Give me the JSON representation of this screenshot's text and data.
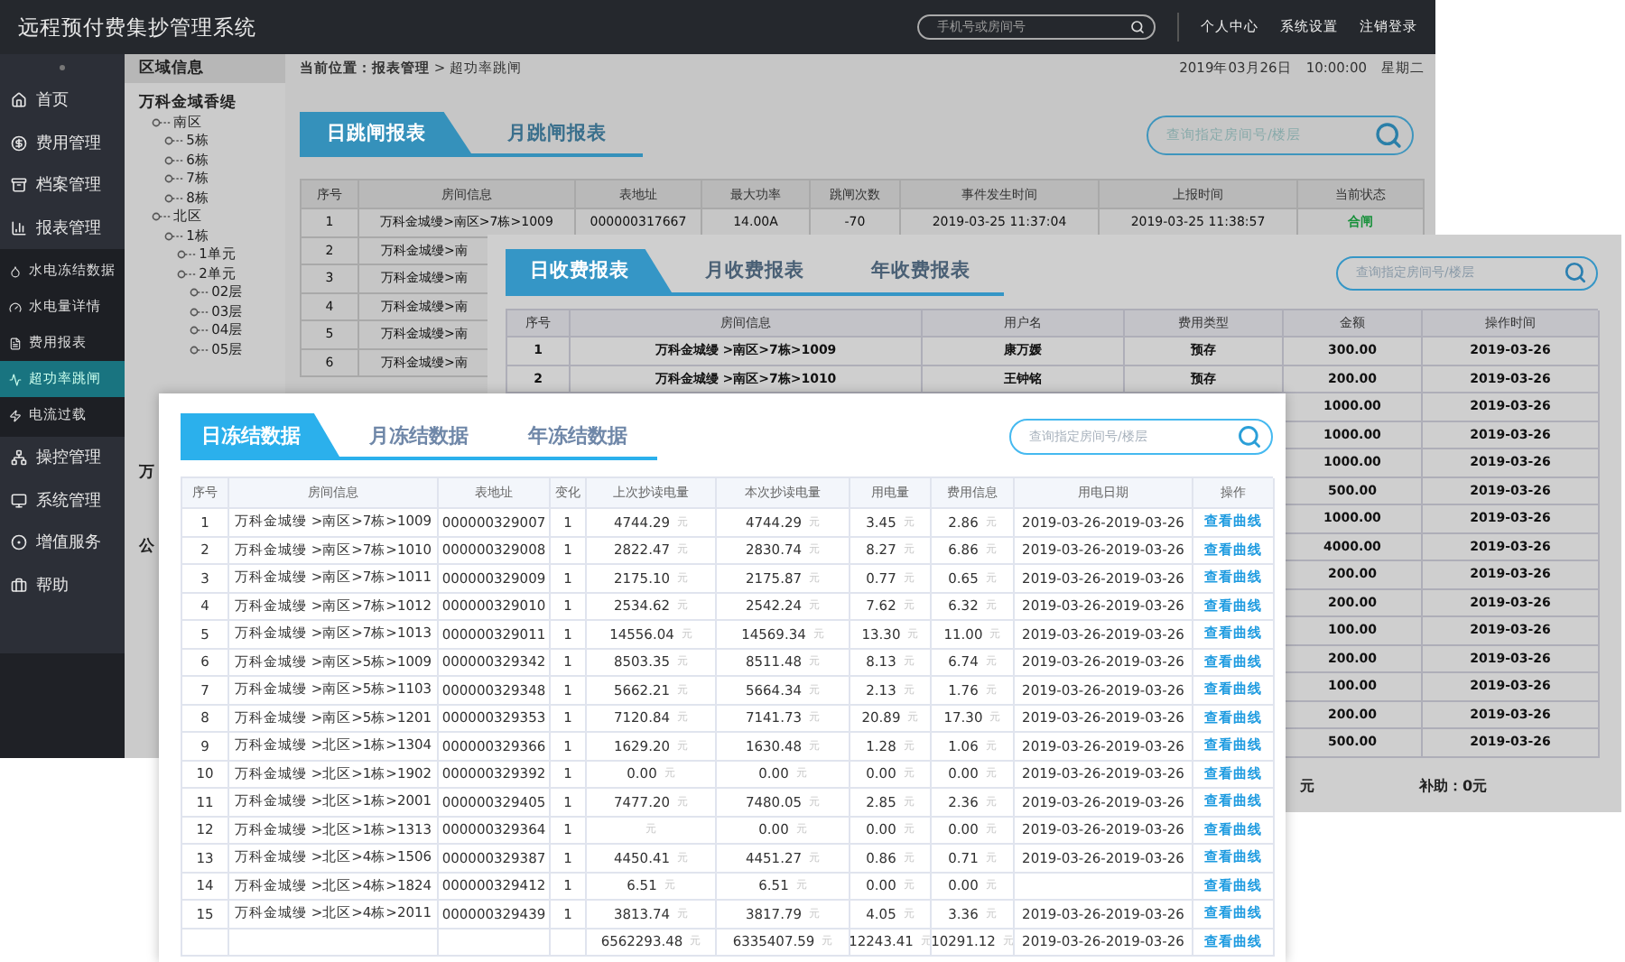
{
  "trip_window": {
    "title": "远程预付费集抄管理系统",
    "search": {
      "placeholder": "手机号或房间号"
    },
    "top_links": [
      "个人中心",
      "系统设置",
      "注销登录"
    ],
    "menu": [
      {
        "label": "首页",
        "selected": false
      },
      {
        "label": "费用管理",
        "selected": false
      },
      {
        "label": "档案管理",
        "selected": false
      },
      {
        "label": "报表管理",
        "selected": false,
        "expanded": true,
        "children": [
          {
            "label": "水电冻结数据",
            "selected": false
          },
          {
            "label": "水电量详情",
            "selected": false
          },
          {
            "label": "费用报表",
            "selected": false
          },
          {
            "label": "超功率跳闸",
            "selected": true
          },
          {
            "label": "电流过载",
            "selected": false
          }
        ]
      },
      {
        "label": "操控管理",
        "selected": false
      },
      {
        "label": "系统管理",
        "selected": false
      },
      {
        "label": "增值服务",
        "selected": false
      },
      {
        "label": "帮助",
        "selected": false
      }
    ],
    "region_panel": {
      "title": "区域信息",
      "tree": [
        {
          "label": "万科金域香缇",
          "children": [
            {
              "label": "南区",
              "children": [
                {
                  "label": "5栋"
                },
                {
                  "label": "6栋"
                },
                {
                  "label": "7栋"
                },
                {
                  "label": "8栋"
                }
              ]
            },
            {
              "label": "北区",
              "children": [
                {
                  "label": "1栋",
                  "children": [
                    {
                      "label": "1单元"
                    },
                    {
                      "label": "2单元",
                      "children": [
                        {
                          "label": "02层"
                        },
                        {
                          "label": "03层"
                        },
                        {
                          "label": "04层"
                        },
                        {
                          "label": "05层"
                        }
                      ]
                    }
                  ]
                }
              ]
            }
          ]
        },
        {
          "label": "万"
        },
        {
          "label": "公"
        }
      ]
    },
    "breadcrumb": "**当前位置：报表管理** > 超功率跳闸",
    "datetime": [
      "2019年03月26日",
      "10:00:00",
      "星期二"
    ],
    "tabs": [
      {
        "label": "日跳闸报表",
        "selected": true
      },
      {
        "label": "月跳闸报表",
        "selected": false
      }
    ],
    "table_search": {
      "placeholder": "查询指定房间号/楼层"
    },
    "table": {
      "columns": [
        {
          "label": "序号",
          "kind": "text"
        },
        {
          "label": "房间信息",
          "kind": "text"
        },
        {
          "label": "表地址",
          "kind": "text"
        },
        {
          "label": "最大功率",
          "kind": "text"
        },
        {
          "label": "跳闸次数",
          "kind": "text"
        },
        {
          "label": "事件发生时间",
          "kind": "text"
        },
        {
          "label": "上报时间",
          "kind": "text"
        },
        {
          "label": "当前状态",
          "kind": "status"
        }
      ],
      "rows": [
        {
          "cells": [
            "1",
            "万科金城缦>南区>7栋>1009",
            "000000317667",
            "14.00A",
            "-70",
            "2019-03-25  11:37:04",
            "2019-03-25  11:38:57",
            "合闸"
          ]
        },
        {
          "cells": [
            "2",
            "万科金城缦>南"
          ]
        },
        {
          "cells": [
            "3",
            "万科金城缦>南"
          ]
        },
        {
          "cells": [
            "4",
            "万科金城缦>南"
          ]
        },
        {
          "cells": [
            "5",
            "万科金城缦>南"
          ]
        },
        {
          "cells": [
            "6",
            "万科金城缦>南"
          ]
        }
      ]
    }
  },
  "fee_window": {
    "tabs": [
      {
        "label": "日收费报表",
        "selected": true
      },
      {
        "label": "月收费报表",
        "selected": false
      },
      {
        "label": "年收费报表",
        "selected": false
      }
    ],
    "search": {
      "placeholder": "查询指定房间号/楼层"
    },
    "table": {
      "columns": [
        {
          "label": "序号"
        },
        {
          "label": "房间信息"
        },
        {
          "label": "用户名"
        },
        {
          "label": "费用类型"
        },
        {
          "label": "金额"
        },
        {
          "label": "操作时间"
        }
      ],
      "rows": [
        {
          "cells": [
            "1",
            "万科金城缦 >南区>7栋>1009",
            "康万媛",
            "预存",
            "300.00",
            "2019-03-26"
          ]
        },
        {
          "cells": [
            "2",
            "万科金城缦 >南区>7栋>1010",
            "王钟铭",
            "预存",
            "200.00",
            "2019-03-26"
          ]
        },
        {
          "tail": [
            "1000.00",
            "2019-03-26"
          ]
        },
        {
          "tail": [
            "1000.00",
            "2019-03-26"
          ]
        },
        {
          "tail": [
            "1000.00",
            "2019-03-26"
          ]
        },
        {
          "tail": [
            "500.00",
            "2019-03-26"
          ]
        },
        {
          "tail": [
            "1000.00",
            "2019-03-26"
          ]
        },
        {
          "tail": [
            "4000.00",
            "2019-03-26"
          ]
        },
        {
          "tail": [
            "200.00",
            "2019-03-26"
          ]
        },
        {
          "tail": [
            "200.00",
            "2019-03-26"
          ]
        },
        {
          "tail": [
            "100.00",
            "2019-03-26"
          ]
        },
        {
          "tail": [
            "200.00",
            "2019-03-26"
          ]
        },
        {
          "tail": [
            "100.00",
            "2019-03-26"
          ]
        },
        {
          "tail": [
            "200.00",
            "2019-03-26"
          ]
        },
        {
          "tail": [
            "500.00",
            "2019-03-26"
          ]
        }
      ]
    },
    "footer": [
      "元",
      "补助：0元"
    ]
  },
  "freeze_window": {
    "tabs": [
      {
        "label": "日冻结数据",
        "selected": true
      },
      {
        "label": "月冻结数据",
        "selected": false
      },
      {
        "label": "年冻结数据",
        "selected": false
      }
    ],
    "search": {
      "placeholder": "查询指定房间号/楼层"
    },
    "table": {
      "columns": [
        {
          "label": "序号",
          "kind": "text"
        },
        {
          "label": "房间信息",
          "kind": "text"
        },
        {
          "label": "表地址",
          "kind": "text"
        },
        {
          "label": "变化",
          "kind": "text"
        },
        {
          "label": "上次抄读电量",
          "kind": "reading"
        },
        {
          "label": "本次抄读电量",
          "kind": "reading"
        },
        {
          "label": "用电量",
          "kind": "reading"
        },
        {
          "label": "费用信息",
          "kind": "reading"
        },
        {
          "label": "用电日期",
          "kind": "text"
        },
        {
          "label": "操作",
          "kind": "link"
        }
      ],
      "rows": [
        {
          "cells": [
            "1",
            "万科金城缦 >南区>7栋>1009",
            "000000329007",
            "1",
            "4744.29",
            "4744.29",
            "3.45",
            "2.86",
            "2019-03-26-2019-03-26",
            "查看曲线"
          ],
          "units": [
            "元",
            "元",
            "元",
            "元"
          ]
        },
        {
          "cells": [
            "2",
            "万科金城缦 >南区>7栋>1010",
            "000000329008",
            "1",
            "2822.47",
            "2830.74",
            "8.27",
            "6.86",
            "2019-03-26-2019-03-26",
            "查看曲线"
          ],
          "units": [
            "元",
            "元",
            "元",
            "元"
          ]
        },
        {
          "cells": [
            "3",
            "万科金城缦 >南区>7栋>1011",
            "000000329009",
            "1",
            "2175.10",
            "2175.87",
            "0.77",
            "0.65",
            "2019-03-26-2019-03-26",
            "查看曲线"
          ],
          "units": [
            "元",
            "元",
            "元",
            "元"
          ]
        },
        {
          "cells": [
            "4",
            "万科金城缦 >南区>7栋>1012",
            "000000329010",
            "1",
            "2534.62",
            "2542.24",
            "7.62",
            "6.32",
            "2019-03-26-2019-03-26",
            "查看曲线"
          ],
          "units": [
            "元",
            "元",
            "元",
            "元"
          ]
        },
        {
          "cells": [
            "5",
            "万科金城缦 >南区>7栋>1013",
            "000000329011",
            "1",
            "14556.04",
            "14569.34",
            "13.30",
            "11.00",
            "2019-03-26-2019-03-26",
            "查看曲线"
          ],
          "units": [
            "元",
            "元",
            "元",
            "元"
          ]
        },
        {
          "cells": [
            "6",
            "万科金城缦 >南区>5栋>1009",
            "000000329342",
            "1",
            "8503.35",
            "8511.48",
            "8.13",
            "6.74",
            "2019-03-26-2019-03-26",
            "查看曲线"
          ],
          "units": [
            "元",
            "元",
            "元",
            "元"
          ]
        },
        {
          "cells": [
            "7",
            "万科金城缦 >南区>5栋>1103",
            "000000329348",
            "1",
            "5662.21",
            "5664.34",
            "2.13",
            "1.76",
            "2019-03-26-2019-03-26",
            "查看曲线"
          ],
          "units": [
            "元",
            "元",
            "元",
            "元"
          ]
        },
        {
          "cells": [
            "8",
            "万科金城缦 >南区>5栋>1201",
            "000000329353",
            "1",
            "7120.84",
            "7141.73",
            "20.89",
            "17.30",
            "2019-03-26-2019-03-26",
            "查看曲线"
          ],
          "units": [
            "元",
            "元",
            "元",
            "元"
          ]
        },
        {
          "cells": [
            "9",
            "万科金城缦 >北区>1栋>1304",
            "000000329366",
            "1",
            "1629.20",
            "1630.48",
            "1.28",
            "1.06",
            "2019-03-26-2019-03-26",
            "查看曲线"
          ],
          "units": [
            "元",
            "元",
            "元",
            "元"
          ]
        },
        {
          "cells": [
            "10",
            "万科金城缦 >北区>1栋>1902",
            "000000329392",
            "1",
            "0.00",
            "0.00",
            "0.00",
            "0.00",
            "2019-03-26-2019-03-26",
            "查看曲线"
          ],
          "units": [
            "元",
            "元",
            "元",
            "元"
          ]
        },
        {
          "cells": [
            "11",
            "万科金城缦 >北区>1栋>2001",
            "000000329405",
            "1",
            "7477.20",
            "7480.05",
            "2.85",
            "2.36",
            "2019-03-26-2019-03-26",
            "查看曲线"
          ],
          "units": [
            "元",
            "元",
            "元",
            "元"
          ]
        },
        {
          "cells": [
            "12",
            "万科金城缦 >北区>1栋>1313",
            "000000329364",
            "1",
            "",
            "0.00",
            "0.00",
            "0.00",
            "2019-03-26-2019-03-26",
            "查看曲线"
          ],
          "units": [
            "元",
            "元",
            "元",
            "元"
          ]
        },
        {
          "cells": [
            "13",
            "万科金城缦 >北区>4栋>1506",
            "000000329387",
            "1",
            "4450.41",
            "4451.27",
            "0.86",
            "0.71",
            "2019-03-26-2019-03-26",
            "查看曲线"
          ],
          "units": [
            "元",
            "元",
            "元",
            "元"
          ]
        },
        {
          "cells": [
            "14",
            "万科金城缦 >北区>4栋>1824",
            "000000329412",
            "1",
            "6.51",
            "6.51",
            "0.00",
            "0.00",
            "",
            "查看曲线"
          ],
          "units": [
            "元",
            "元",
            "元",
            "元"
          ]
        },
        {
          "cells": [
            "15",
            "万科金城缦 >北区>4栋>2011",
            "000000329439",
            "1",
            "3813.74",
            "3817.79",
            "4.05",
            "3.36",
            "2019-03-26-2019-03-26",
            "查看曲线"
          ],
          "units": [
            "元",
            "元",
            "元",
            "元"
          ]
        },
        {
          "cells": [
            "",
            "",
            "",
            "",
            "6562293.48",
            "6335407.59",
            "12243.41",
            "10291.12",
            "2019-03-26-2019-03-26",
            "查看曲线"
          ],
          "units": [
            "元",
            "元",
            "元",
            "元"
          ]
        }
      ]
    }
  }
}
